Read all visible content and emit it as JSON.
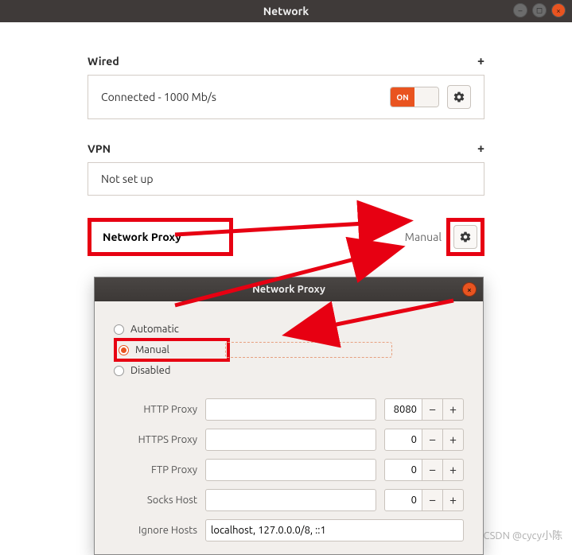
{
  "window": {
    "title": "Network"
  },
  "wired": {
    "header": "Wired",
    "status": "Connected - 1000 Mb/s",
    "toggle_label": "ON"
  },
  "vpn": {
    "header": "VPN",
    "status": "Not set up"
  },
  "proxy": {
    "label": "Network Proxy",
    "mode": "Manual"
  },
  "dialog": {
    "title": "Network Proxy",
    "options": {
      "automatic": "Automatic",
      "manual": "Manual",
      "disabled": "Disabled"
    },
    "rows": {
      "http": {
        "label": "HTTP Proxy",
        "host": "",
        "port": "8080"
      },
      "https": {
        "label": "HTTPS Proxy",
        "host": "",
        "port": "0"
      },
      "ftp": {
        "label": "FTP Proxy",
        "host": "",
        "port": "0"
      },
      "socks": {
        "label": "Socks Host",
        "host": "",
        "port": "0"
      },
      "ignore": {
        "label": "Ignore Hosts",
        "value": "localhost, 127.0.0.0/8, ::1"
      }
    }
  },
  "watermark": "CSDN @cycy小陈"
}
